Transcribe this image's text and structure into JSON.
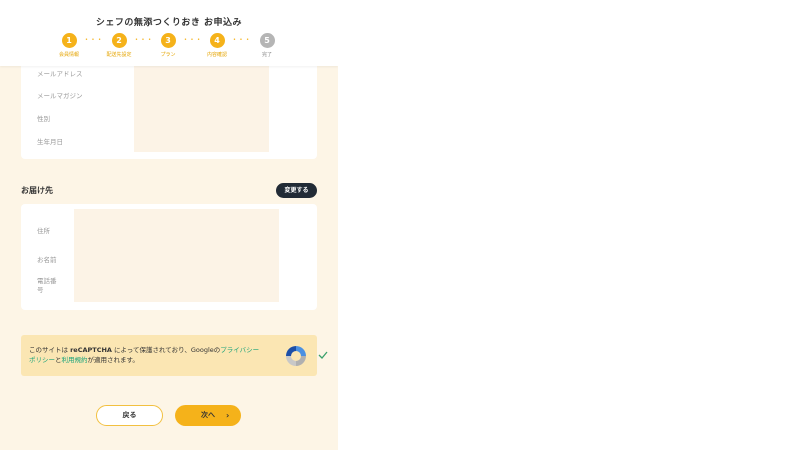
{
  "header": {
    "title": "シェフの無添つくりおき お申込み",
    "steps": [
      {
        "number": "1",
        "label": "会員情報",
        "state": "done"
      },
      {
        "number": "2",
        "label": "配送先設定",
        "state": "done"
      },
      {
        "number": "3",
        "label": "プラン",
        "state": "done"
      },
      {
        "number": "4",
        "label": "内容確認",
        "state": "current"
      },
      {
        "number": "5",
        "label": "完了",
        "state": "inactive"
      }
    ],
    "dots": "• • •"
  },
  "member": {
    "labels": [
      "メールアドレス",
      "メールマガジン",
      "性別",
      "生年月日"
    ]
  },
  "delivery": {
    "title": "お届け先",
    "change_label": "変更する",
    "labels": [
      "住所",
      "お名前",
      "電話番号"
    ]
  },
  "recaptcha": {
    "t1": "このサイトは ",
    "t2": "reCAPTCHA",
    "t3": " によって保護されており、Googleの",
    "link1": "プライバシーポリシー",
    "t4": "と",
    "link2": "利用規約",
    "t5": "が適用されます。"
  },
  "buttons": {
    "back": "戻る",
    "next": "次へ",
    "next_chevron": "›"
  },
  "colors": {
    "accent": "#f5b21a",
    "inactive_step": "#b5b5b5",
    "background": "#fdf5e6",
    "dark_button": "#222b36",
    "link": "#1aa37a"
  }
}
